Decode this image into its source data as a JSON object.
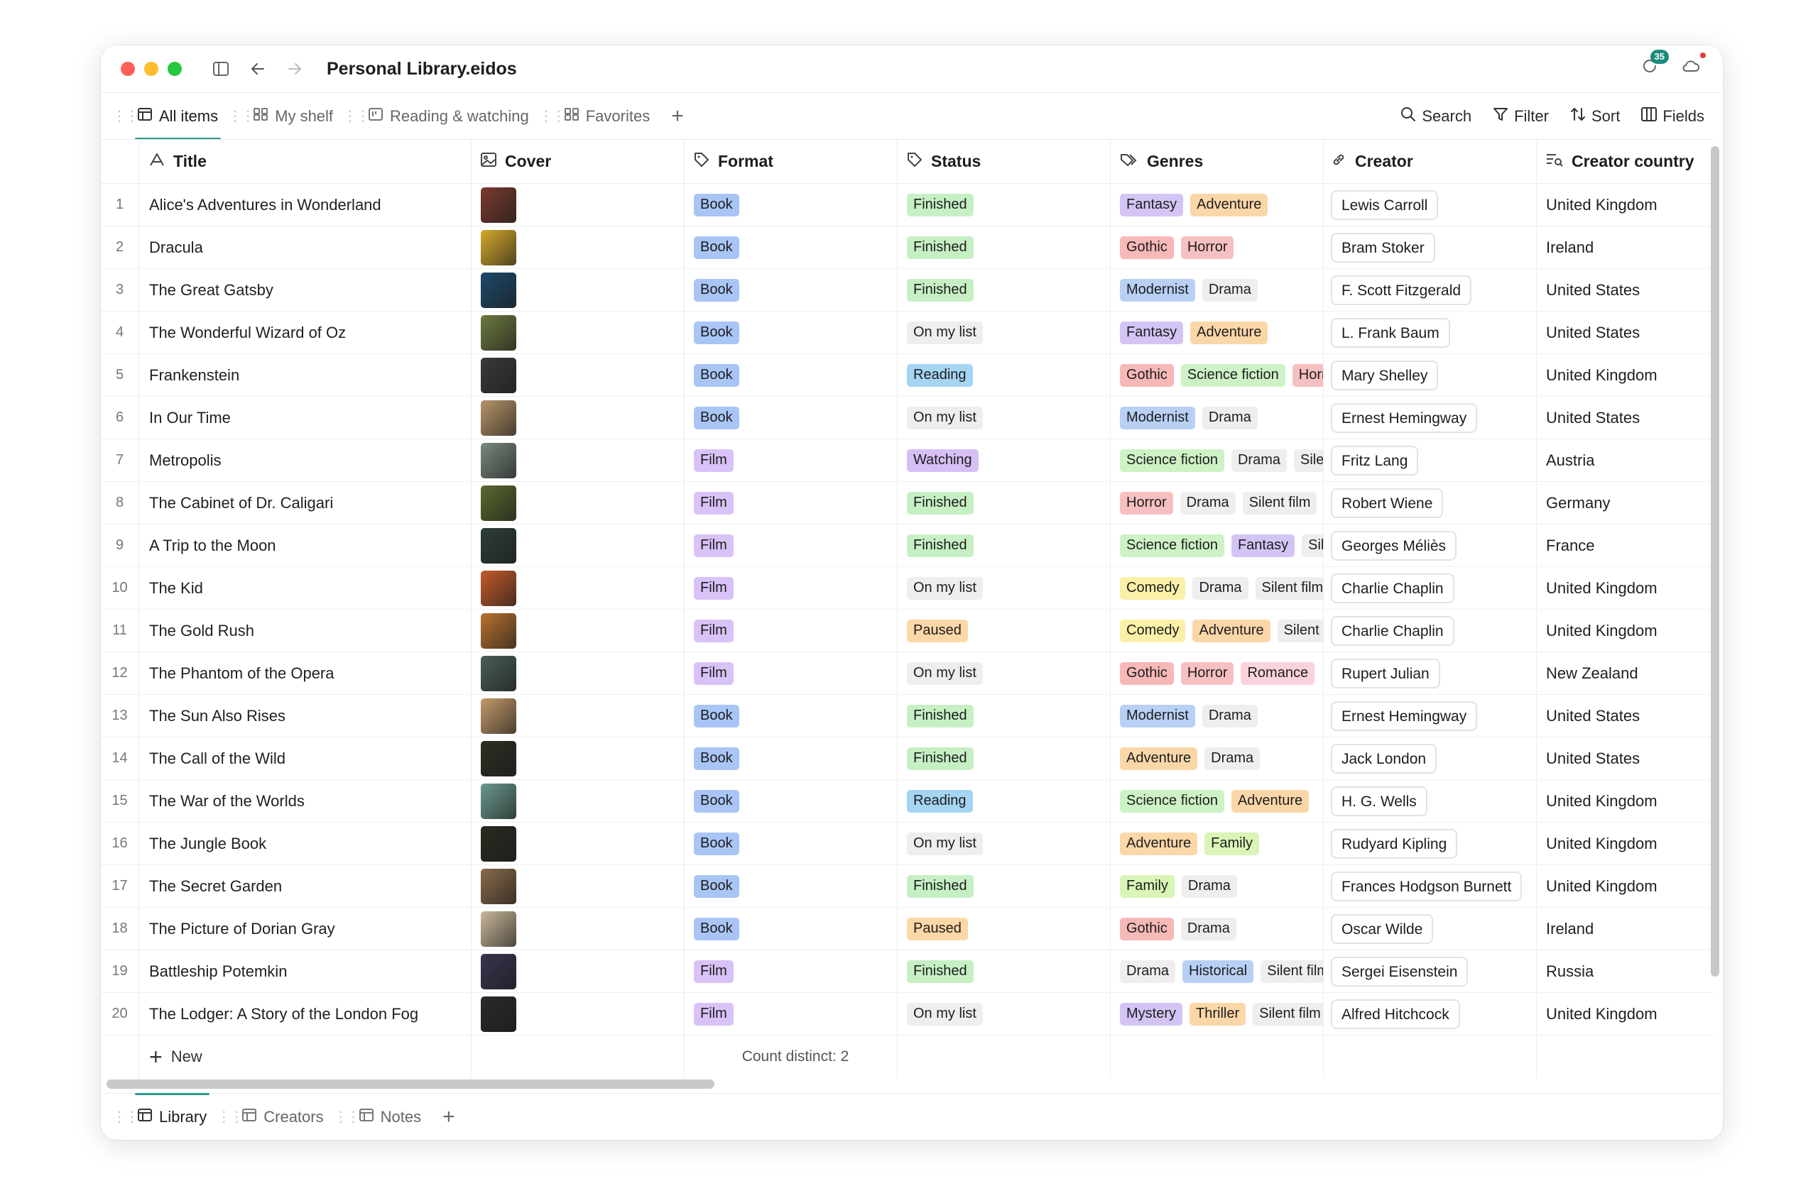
{
  "window": {
    "title": "Personal Library.eidos",
    "sync_badge": "35"
  },
  "views": {
    "tabs": [
      {
        "label": "All items",
        "icon": "table-icon",
        "active": true
      },
      {
        "label": "My shelf",
        "icon": "gallery-icon",
        "active": false
      },
      {
        "label": "Reading & watching",
        "icon": "kanban-icon",
        "active": false
      },
      {
        "label": "Favorites",
        "icon": "gallery-icon",
        "active": false
      }
    ],
    "add_label": "+",
    "tools": [
      {
        "label": "Search",
        "icon": "search-icon"
      },
      {
        "label": "Filter",
        "icon": "filter-icon"
      },
      {
        "label": "Sort",
        "icon": "sort-icon"
      },
      {
        "label": "Fields",
        "icon": "columns-icon"
      }
    ]
  },
  "table": {
    "columns": [
      {
        "label": "Title",
        "icon": "text-type-icon"
      },
      {
        "label": "Cover",
        "icon": "image-icon"
      },
      {
        "label": "Format",
        "icon": "tag-icon"
      },
      {
        "label": "Status",
        "icon": "tag-icon"
      },
      {
        "label": "Genres",
        "icon": "tags-icon"
      },
      {
        "label": "Creator",
        "icon": "link-icon"
      },
      {
        "label": "Creator country",
        "icon": "lookup-icon"
      }
    ],
    "rows": [
      {
        "n": "1",
        "title": "Alice's Adventures in Wonderland",
        "cover": "#7a3b2e",
        "format": "Book",
        "status": "Finished",
        "genres": [
          "Fantasy",
          "Adventure"
        ],
        "creator": "Lewis Carroll",
        "country": "United Kingdom"
      },
      {
        "n": "2",
        "title": "Dracula",
        "cover": "#d6a92a",
        "format": "Book",
        "status": "Finished",
        "genres": [
          "Gothic",
          "Horror"
        ],
        "creator": "Bram Stoker",
        "country": "Ireland"
      },
      {
        "n": "3",
        "title": "The Great Gatsby",
        "cover": "#1d4a6b",
        "format": "Book",
        "status": "Finished",
        "genres": [
          "Modernist",
          "Drama"
        ],
        "creator": "F. Scott Fitzgerald",
        "country": "United States"
      },
      {
        "n": "4",
        "title": "The Wonderful Wizard of Oz",
        "cover": "#6c7a3e",
        "format": "Book",
        "status": "On my list",
        "genres": [
          "Fantasy",
          "Adventure"
        ],
        "creator": "L. Frank Baum",
        "country": "United States"
      },
      {
        "n": "5",
        "title": "Frankenstein",
        "cover": "#3a3a3a",
        "format": "Book",
        "status": "Reading",
        "genres": [
          "Gothic",
          "Science fiction",
          "Horror"
        ],
        "creator": "Mary Shelley",
        "country": "United Kingdom"
      },
      {
        "n": "6",
        "title": "In Our Time",
        "cover": "#b89468",
        "format": "Book",
        "status": "On my list",
        "genres": [
          "Modernist",
          "Drama"
        ],
        "creator": "Ernest Hemingway",
        "country": "United States"
      },
      {
        "n": "7",
        "title": "Metropolis",
        "cover": "#7a8a7e",
        "format": "Film",
        "status": "Watching",
        "genres": [
          "Science fiction",
          "Drama",
          "Silent film"
        ],
        "creator": "Fritz Lang",
        "country": "Austria"
      },
      {
        "n": "8",
        "title": "The Cabinet of Dr. Caligari",
        "cover": "#5a6a2e",
        "format": "Film",
        "status": "Finished",
        "genres": [
          "Horror",
          "Drama",
          "Silent film"
        ],
        "creator": "Robert Wiene",
        "country": "Germany"
      },
      {
        "n": "9",
        "title": "A Trip to the Moon",
        "cover": "#2e3e3a",
        "format": "Film",
        "status": "Finished",
        "genres": [
          "Science fiction",
          "Fantasy",
          "Silent film"
        ],
        "creator": "Georges Méliès",
        "country": "France"
      },
      {
        "n": "10",
        "title": "The Kid",
        "cover": "#c45a2a",
        "format": "Film",
        "status": "On my list",
        "genres": [
          "Comedy",
          "Drama",
          "Silent film"
        ],
        "creator": "Charlie Chaplin",
        "country": "United Kingdom"
      },
      {
        "n": "11",
        "title": "The Gold Rush",
        "cover": "#b8722e",
        "format": "Film",
        "status": "Paused",
        "genres": [
          "Comedy",
          "Adventure",
          "Silent film"
        ],
        "creator": "Charlie Chaplin",
        "country": "United Kingdom"
      },
      {
        "n": "12",
        "title": "The Phantom of the Opera",
        "cover": "#4a5e5a",
        "format": "Film",
        "status": "On my list",
        "genres": [
          "Gothic",
          "Horror",
          "Romance"
        ],
        "creator": "Rupert Julian",
        "country": "New Zealand"
      },
      {
        "n": "13",
        "title": "The Sun Also Rises",
        "cover": "#c49a6a",
        "format": "Book",
        "status": "Finished",
        "genres": [
          "Modernist",
          "Drama"
        ],
        "creator": "Ernest Hemingway",
        "country": "United States"
      },
      {
        "n": "14",
        "title": "The Call of the Wild",
        "cover": "#2e2e24",
        "format": "Book",
        "status": "Finished",
        "genres": [
          "Adventure",
          "Drama"
        ],
        "creator": "Jack London",
        "country": "United States"
      },
      {
        "n": "15",
        "title": "The War of the Worlds",
        "cover": "#6a9a8e",
        "format": "Book",
        "status": "Reading",
        "genres": [
          "Science fiction",
          "Adventure"
        ],
        "creator": "H. G. Wells",
        "country": "United Kingdom"
      },
      {
        "n": "16",
        "title": "The Jungle Book",
        "cover": "#2a2a20",
        "format": "Book",
        "status": "On my list",
        "genres": [
          "Adventure",
          "Family"
        ],
        "creator": "Rudyard Kipling",
        "country": "United Kingdom"
      },
      {
        "n": "17",
        "title": "The Secret Garden",
        "cover": "#8a6a4a",
        "format": "Book",
        "status": "Finished",
        "genres": [
          "Family",
          "Drama"
        ],
        "creator": "Frances Hodgson Burnett",
        "country": "United Kingdom"
      },
      {
        "n": "18",
        "title": "The Picture of Dorian Gray",
        "cover": "#c9b89a",
        "format": "Book",
        "status": "Paused",
        "genres": [
          "Gothic",
          "Drama"
        ],
        "creator": "Oscar Wilde",
        "country": "Ireland"
      },
      {
        "n": "19",
        "title": "Battleship Potemkin",
        "cover": "#3a3450",
        "format": "Film",
        "status": "Finished",
        "genres": [
          "Drama",
          "Historical",
          "Silent film"
        ],
        "creator": "Sergei Eisenstein",
        "country": "Russia"
      },
      {
        "n": "20",
        "title": "The Lodger: A Story of the London Fog",
        "cover": "#2a2a2a",
        "format": "Film",
        "status": "On my list",
        "genres": [
          "Mystery",
          "Thriller",
          "Silent film"
        ],
        "creator": "Alfred Hitchcock",
        "country": "United Kingdom"
      }
    ],
    "footer": {
      "new_label": "New",
      "count_label": "Count distinct: 2"
    }
  },
  "tag_colors": {
    "Book": "#a9c5f5",
    "Film": "#d9c2f7",
    "Finished": "#c6f0c4",
    "On my list": "#eeeeee",
    "Reading": "#a5d5f3",
    "Watching": "#d6bff5",
    "Paused": "#fbd8a6",
    "Fantasy": "#d4c4f5",
    "Adventure": "#fbd7a8",
    "Gothic": "#f7b8b8",
    "Horror": "#f7c0c0",
    "Modernist": "#b9d0f5",
    "Drama": "#eeeeee",
    "Science fiction": "#cdf2c5",
    "Silent film": "#eeeeee",
    "Comedy": "#fbf0a8",
    "Romance": "#fbd3dd",
    "Family": "#d9f5b8",
    "Historical": "#b9d0f5",
    "Mystery": "#d4c4f5",
    "Thriller": "#fbd7a8"
  },
  "bottom_tabs": [
    {
      "label": "Library",
      "icon": "table-icon",
      "active": true
    },
    {
      "label": "Creators",
      "icon": "table-icon",
      "active": false
    },
    {
      "label": "Notes",
      "icon": "table-icon",
      "active": false
    }
  ],
  "bottom_add_label": "+"
}
